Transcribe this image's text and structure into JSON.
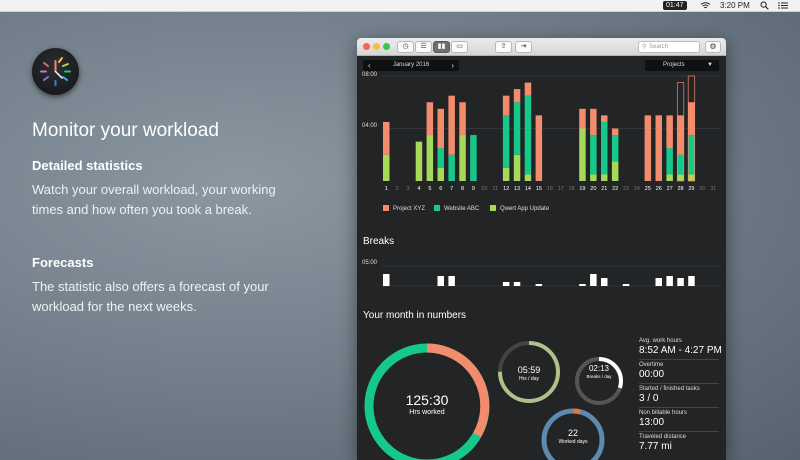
{
  "menubar": {
    "clock": "01:47",
    "time": "3:20 PM",
    "search_icon": "magnifier-icon",
    "list_icon": "list-icon"
  },
  "promo": {
    "headline": "Monitor your workload",
    "sections": [
      {
        "title": "Detailed statistics",
        "body": "Watch your overall workload, your working times and how often you took a break."
      },
      {
        "title": "Forecasts",
        "body": "The statistic also offers a forecast of your workload for the next weeks."
      }
    ]
  },
  "toolbar": {
    "search_placeholder": "Search",
    "buttons": [
      "timer-icon",
      "list-icon",
      "chart-icon",
      "inbox-icon",
      "export-icon",
      "share-icon"
    ]
  },
  "controls": {
    "month": "January 2016",
    "filter": "Projects"
  },
  "colors": {
    "project_xyz": "#f28c6c",
    "website_abc": "#16c98a",
    "qwert": "#a6d957",
    "window_bg": "#222426"
  },
  "chart_data": {
    "type": "bar",
    "title": "",
    "ylabel": "",
    "y_ticks": [
      "08:00",
      "04:00"
    ],
    "ylim_hours": [
      0,
      8
    ],
    "categories": [
      "1",
      "2",
      "3",
      "4",
      "5",
      "6",
      "7",
      "8",
      "9",
      "10",
      "11",
      "12",
      "13",
      "14",
      "15",
      "16",
      "17",
      "18",
      "19",
      "20",
      "21",
      "22",
      "23",
      "24",
      "25",
      "26",
      "27",
      "28",
      "29",
      "30",
      "31"
    ],
    "series": [
      {
        "name": "Project XYZ",
        "values": [
          2.5,
          0,
          0,
          0,
          2.5,
          3.0,
          4.5,
          2.5,
          0,
          0,
          0,
          1.5,
          1.0,
          1.0,
          5.0,
          0,
          0,
          0,
          1.5,
          2.0,
          0.5,
          0.5,
          0,
          0,
          5.0,
          5.0,
          2.5,
          3.0,
          2.5,
          0,
          0
        ]
      },
      {
        "name": "Website ABC",
        "values": [
          0,
          0,
          0,
          0,
          0,
          1.5,
          2.0,
          0,
          3.5,
          0,
          0,
          4.0,
          4.0,
          6.0,
          0,
          0,
          0,
          0,
          0,
          3.0,
          4.0,
          2.0,
          0,
          0,
          0,
          0,
          2.0,
          1.5,
          3.0,
          0,
          0
        ]
      },
      {
        "name": "Qwert App Update",
        "values": [
          2.0,
          0,
          0,
          3.0,
          3.5,
          1.0,
          0,
          3.5,
          0,
          0,
          0,
          1.0,
          2.0,
          0.5,
          0,
          0,
          0,
          0,
          4.0,
          0.5,
          0.5,
          1.5,
          0,
          0,
          0,
          0,
          0.5,
          0.5,
          0.5,
          0,
          0
        ]
      }
    ],
    "forecast_days": [
      "28",
      "29"
    ],
    "breaks": {
      "y_tick": "05:00",
      "values": [
        3.0,
        0,
        0,
        0,
        0,
        2.5,
        2.5,
        0,
        0,
        0,
        0,
        1.0,
        1.0,
        0,
        0.5,
        0,
        0,
        0,
        0.5,
        3.0,
        2.0,
        0,
        0.5,
        0,
        0,
        2.0,
        2.5,
        2.0,
        2.5,
        0,
        0
      ]
    }
  },
  "breaks_title": "Breaks",
  "numbers": {
    "title": "Your month in numbers",
    "main_ring": {
      "value": "125:30",
      "label": "Hrs worked"
    },
    "hrs_day": {
      "value": "05:59",
      "label": "Hrs / day",
      "fraction": 0.75
    },
    "breaks_day": {
      "value": "02:13",
      "label": "Breaks / day",
      "fraction": 0.3
    },
    "worked_days": {
      "value": "22",
      "label": "Worked days",
      "fraction": 0.04
    },
    "stats": [
      {
        "label": "Avg. work hours",
        "value": "8:52 AM - 4:27 PM"
      },
      {
        "label": "Overtime",
        "value": "00:00"
      },
      {
        "label": "Started / finished tasks",
        "value": "3 / 0"
      },
      {
        "label": "Non billable hours",
        "value": "13:00"
      },
      {
        "label": "Traveled distance",
        "value": "7.77 mi"
      }
    ]
  }
}
